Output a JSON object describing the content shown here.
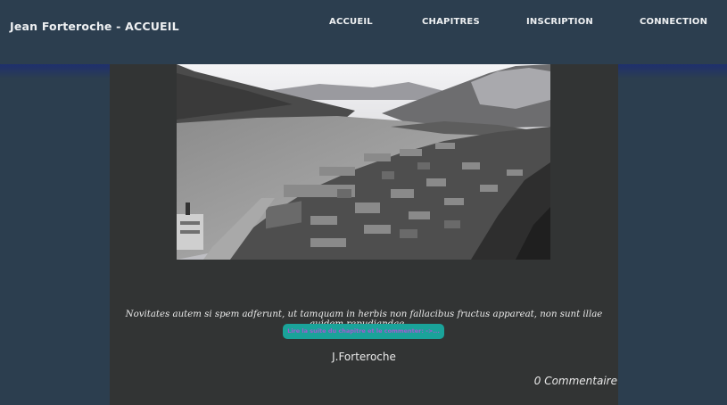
{
  "header": {
    "brand": "Jean Forteroche - ACCUEIL",
    "nav": [
      {
        "label": "ACCUEIL"
      },
      {
        "label": "CHAPITRES"
      },
      {
        "label": "INSCRIPTION"
      },
      {
        "label": "CONNECTION"
      }
    ]
  },
  "post": {
    "image_subject": "black-and-white historic photo of a river town in a valley",
    "excerpt": "Novitates autem si spem adferunt, ut tamquam in herbis non fallacibus fructus appareat, non sunt illae quidem repudiandae, ...",
    "read_more_label": "Lire la suite du chapitre et le commenter: ->...",
    "author": "J.Forteroche",
    "comments": "0 Commentaire"
  },
  "colors": {
    "page_bg": "#2c3e4f",
    "content_bg": "#323434",
    "button_bg": "#1aa39a",
    "button_text": "#a35bd0"
  }
}
